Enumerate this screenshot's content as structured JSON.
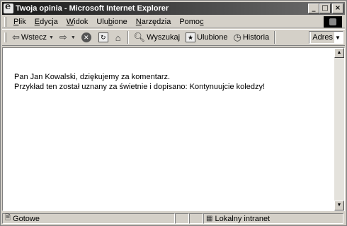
{
  "window": {
    "title": "Twoja opinia - Microsoft Internet Explorer",
    "minimize_glyph": "_",
    "maximize_glyph": "□",
    "close_glyph": "×"
  },
  "menu": [
    {
      "pre": "",
      "u": "P",
      "post": "lik"
    },
    {
      "pre": "",
      "u": "E",
      "post": "dycja"
    },
    {
      "pre": "",
      "u": "W",
      "post": "idok"
    },
    {
      "pre": "Ulu",
      "u": "b",
      "post": "ione"
    },
    {
      "pre": "",
      "u": "N",
      "post": "arzędzia"
    },
    {
      "pre": "Pomo",
      "u": "c",
      "post": ""
    }
  ],
  "toolbar": {
    "back_label": "Wstecz",
    "search_label": "Wyszukaj",
    "favorites_label": "Ulubione",
    "history_label": "Historia",
    "address_label": "Adres"
  },
  "content": {
    "line1": "Pan Jan Kowalski, dziękujemy za komentarz.",
    "line2": "Przykład ten został uznany za świetnie i dopisano: Kontynuujcie koledzy!"
  },
  "status": {
    "text": "Gotowe",
    "zone": "Lokalny intranet"
  },
  "icons": [
    "ie-logo-icon",
    "back-arrow-icon",
    "forward-arrow-icon",
    "stop-icon",
    "refresh-icon",
    "home-icon",
    "search-icon",
    "favorites-icon",
    "history-icon",
    "intranet-icon"
  ]
}
